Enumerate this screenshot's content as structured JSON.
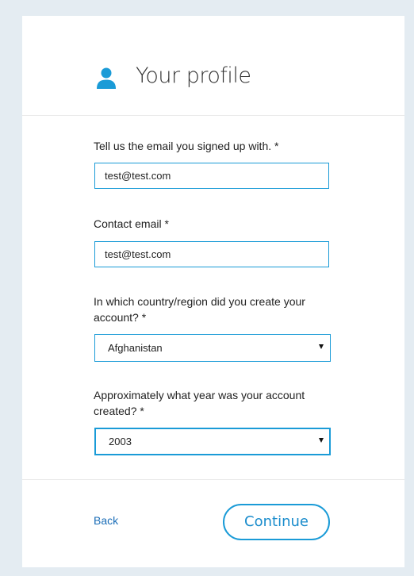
{
  "header": {
    "title": "Your profile",
    "icon": "person-icon",
    "icon_color": "#1a9bd7"
  },
  "form": {
    "signup_email": {
      "label": "Tell us the email you signed up with. *",
      "value": "test@test.com"
    },
    "contact_email": {
      "label": "Contact email *",
      "value": "test@test.com"
    },
    "country": {
      "label": "In which country/region did you create your account? *",
      "selected": "Afghanistan"
    },
    "year": {
      "label": "Approximately what year was your account created? *",
      "selected": "2003"
    }
  },
  "footer": {
    "back_label": "Back",
    "continue_label": "Continue"
  },
  "colors": {
    "accent": "#1a9bd7",
    "link": "#1a6db7",
    "page_background": "#e4ecf2"
  }
}
